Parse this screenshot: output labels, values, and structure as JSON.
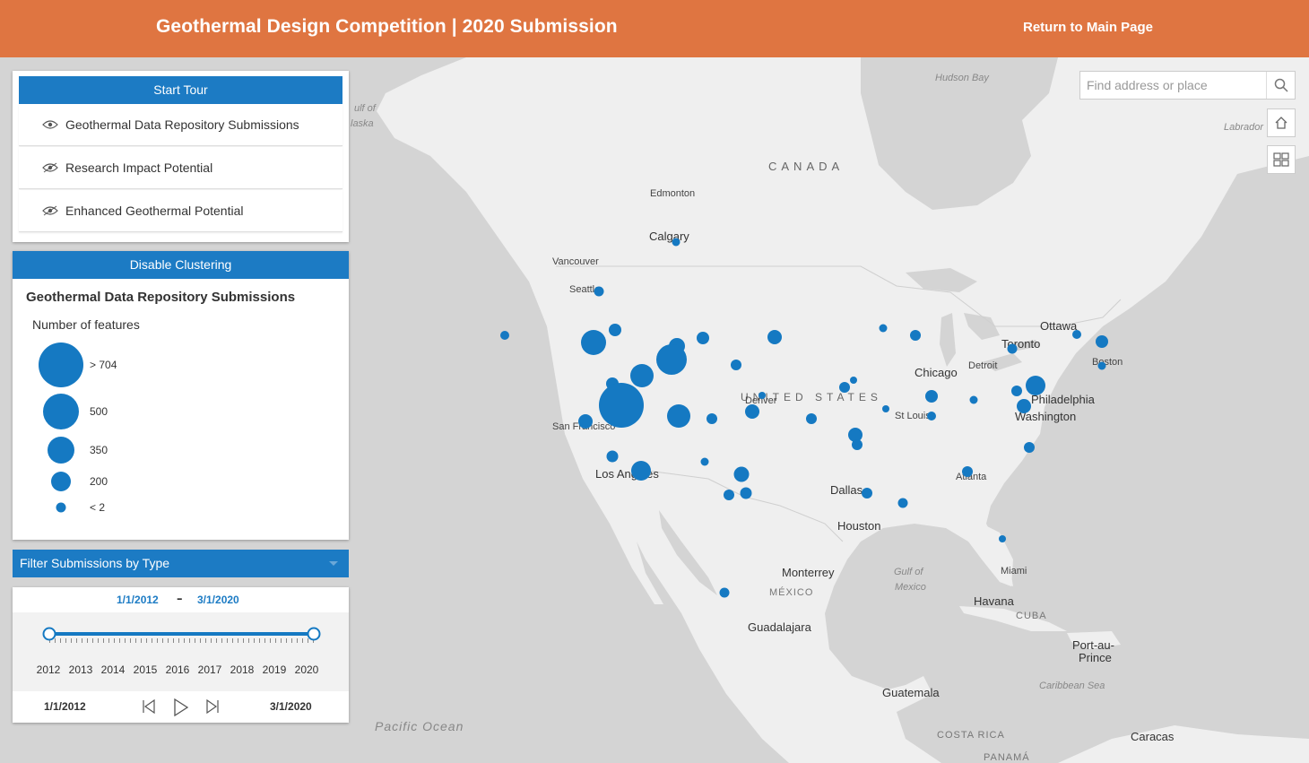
{
  "header": {
    "title": "Geothermal Design Competition | 2020 Submission",
    "return_link": "Return to Main Page"
  },
  "tour": {
    "start_label": "Start Tour",
    "items": [
      {
        "label": "Geothermal Data Repository Submissions"
      },
      {
        "label": "Research Impact Potential"
      },
      {
        "label": "Enhanced Geothermal Potential"
      }
    ]
  },
  "legend": {
    "clustering_label": "Disable Clustering",
    "title": "Geothermal Data Repository Submissions",
    "subtitle": "Number of features",
    "classes": [
      "> 704",
      "500",
      "350",
      "200",
      "< 2"
    ]
  },
  "filter": {
    "label": "Filter Submissions by Type"
  },
  "time_slider": {
    "range_start": "1/1/2012",
    "range_end": "3/1/2020",
    "separator": "–",
    "years": [
      "2012",
      "2013",
      "2014",
      "2015",
      "2016",
      "2017",
      "2018",
      "2019",
      "2020"
    ],
    "current_start": "1/1/2012",
    "current_end": "3/1/2020"
  },
  "search": {
    "placeholder": "Find address or place"
  },
  "map_labels": {
    "hudson_bay": "Hudson Bay",
    "labrador": "Labrador",
    "gulf_of_alaska_1": "ulf of",
    "gulf_of_alaska_2": "laska",
    "canada": "CANADA",
    "edmonton": "Edmonton",
    "calgary": "Calgary",
    "vancouver": "Vancouver",
    "seattle": "Seattle",
    "ottawa": "Ottawa",
    "toronto": "Toronto",
    "detroit": "Detroit",
    "chicago": "Chicago",
    "boston": "Boston",
    "philadelphia": "Philadelphia",
    "washington": "Washington",
    "united_states": "UNITED STATES",
    "denver": "Denver",
    "st_louis": "St Louis",
    "san_francisco": "San Francisco",
    "los_angeles": "Los Angeles",
    "atlanta": "Atlanta",
    "dallas": "Dallas",
    "houston": "Houston",
    "miami": "Miami",
    "monterrey": "Monterrey",
    "gulf_mexico_1": "Gulf of",
    "gulf_mexico_2": "Mexico",
    "mexico": "MÉXICO",
    "havana": "Havana",
    "cuba": "CUBA",
    "guadalajara": "Guadalajara",
    "port_au_prince_1": "Port-au-",
    "port_au_prince_2": "Prince",
    "caribbean": "Caribbean Sea",
    "guatemala": "Guatemala",
    "pacific": "Pacific Ocean",
    "costa_rica": "COSTA RICA",
    "panama": "PANAMÁ",
    "caracas": "Caracas"
  },
  "colors": {
    "header": "#df7541",
    "accent": "#1c7bc4",
    "symbol": "#1579c2",
    "land": "#efefef",
    "water": "#d4d4d4"
  },
  "icons": [
    "eye-icon",
    "search-icon",
    "home-icon",
    "basemap-icon",
    "previous-icon",
    "play-icon",
    "next-icon"
  ]
}
